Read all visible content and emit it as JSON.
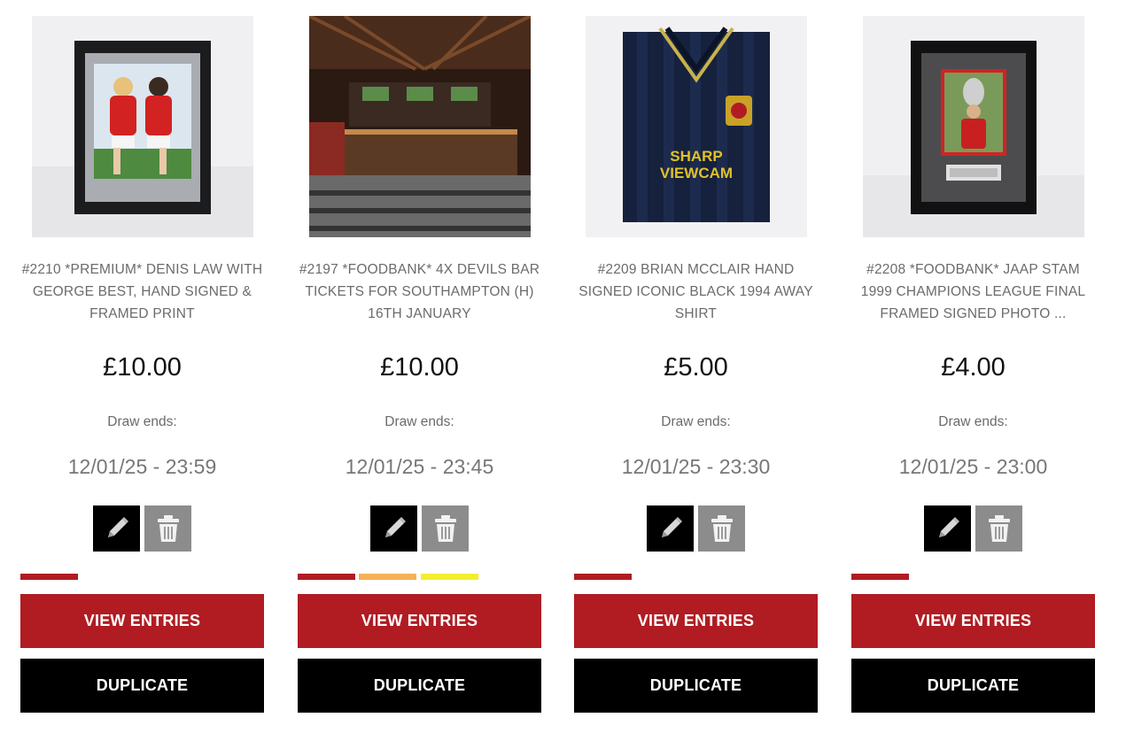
{
  "colors": {
    "accent": "#b01c22",
    "black": "#000000",
    "grey_button": "#8c8c8c",
    "orange": "#f5b158",
    "yellow": "#f3ee2f"
  },
  "labels": {
    "draw_ends": "Draw ends:",
    "view_entries": "VIEW ENTRIES",
    "duplicate": "DUPLICATE"
  },
  "icons": {
    "edit": "pencil-icon",
    "delete": "trash-icon"
  },
  "cards": [
    {
      "image": "framed-print-denis-law-george-best",
      "title": "#2210 *PREMIUM* DENIS LAW WITH GEORGE BEST, HAND SIGNED & FRAMED PRINT",
      "price": "£10.00",
      "draw_ends": "12/01/25 - 23:59",
      "bars": [
        "#b01c22"
      ]
    },
    {
      "image": "devils-bar-interior",
      "title": "#2197 *FOODBANK* 4X DEVILS BAR TICKETS FOR SOUTHAMPTON (H) 16TH JANUARY",
      "price": "£10.00",
      "draw_ends": "12/01/25 - 23:45",
      "bars": [
        "#b01c22",
        "#f5b158",
        "#f3ee2f"
      ]
    },
    {
      "image": "black-1994-away-shirt",
      "title": "#2209 BRIAN MCCLAIR HAND SIGNED ICONIC BLACK 1994 AWAY SHIRT",
      "price": "£5.00",
      "draw_ends": "12/01/25 - 23:30",
      "bars": [
        "#b01c22"
      ]
    },
    {
      "image": "jaap-stam-framed-photo",
      "title": "#2208 *FOODBANK* JAAP STAM 1999 CHAMPIONS LEAGUE FINAL FRAMED SIGNED PHOTO ...",
      "price": "£4.00",
      "draw_ends": "12/01/25 - 23:00",
      "bars": [
        "#b01c22"
      ]
    }
  ],
  "image_text": {
    "shirt_sponsor_top": "SHARP",
    "shirt_sponsor_bottom": "VIEWCAM"
  }
}
